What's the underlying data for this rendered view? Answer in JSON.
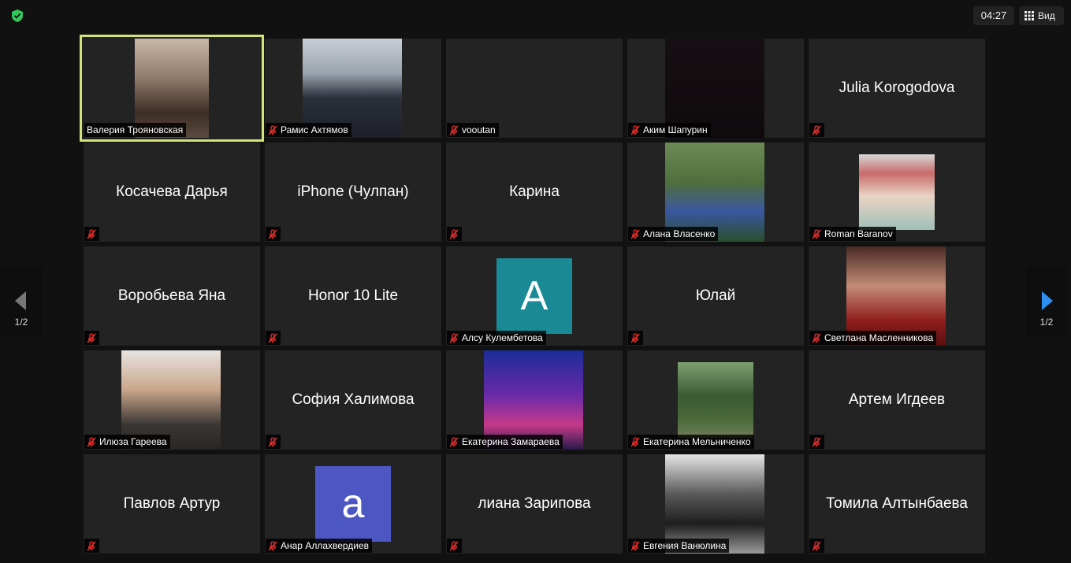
{
  "timer": "04:27",
  "view_label": "Вид",
  "page_indicator": "1/2",
  "colors": {
    "speaking_border": "#d4e27a",
    "mute_red": "#e63232",
    "shield_green": "#33c95a",
    "arrow_blue": "#2e8ff0",
    "avatar_teal": "#1a8a96",
    "avatar_indigo": "#4d57c4"
  },
  "participants": [
    {
      "id": "t0",
      "name": "Валерия Трояновская",
      "type": "video",
      "muted": false,
      "speaking": true
    },
    {
      "id": "t1",
      "name": "Рамис Ахтямов",
      "type": "video",
      "muted": true
    },
    {
      "id": "t2",
      "name": "vooutan",
      "type": "blank",
      "muted": true
    },
    {
      "id": "t3",
      "name": "Аким Шапурин",
      "type": "video",
      "muted": true
    },
    {
      "id": "t4",
      "name": "Julia Korogodova",
      "type": "name",
      "muted": true
    },
    {
      "id": "t5",
      "name": "Косачева Дарья",
      "type": "name",
      "muted": true
    },
    {
      "id": "t6",
      "name": "iPhone (Чулпан)",
      "type": "name",
      "muted": true
    },
    {
      "id": "t7",
      "name": "Карина",
      "type": "name",
      "muted": true
    },
    {
      "id": "t8",
      "name": "Алана Власенко",
      "type": "video",
      "muted": true
    },
    {
      "id": "t9",
      "name": "Roman Baranov",
      "type": "video",
      "muted": true
    },
    {
      "id": "t10",
      "name": "Воробьева Яна",
      "type": "name",
      "muted": true
    },
    {
      "id": "t11",
      "name": "Honor 10 Lite",
      "type": "name",
      "muted": true
    },
    {
      "id": "t12",
      "name": "Алсу Кулембетова",
      "type": "avatar",
      "avatar_letter": "A",
      "muted": true
    },
    {
      "id": "t13",
      "name": "Юлай",
      "type": "name",
      "muted": true
    },
    {
      "id": "t14",
      "name": "Светлана Масленникова",
      "type": "video",
      "muted": true
    },
    {
      "id": "t15",
      "name": "Илюза Гареева",
      "type": "video",
      "muted": true
    },
    {
      "id": "t16",
      "name": "София Халимова",
      "type": "name",
      "muted": true
    },
    {
      "id": "t17",
      "name": "Екатерина Замараева",
      "type": "video",
      "muted": true
    },
    {
      "id": "t18",
      "name": "Екатерина Мельниченко",
      "type": "video",
      "muted": true
    },
    {
      "id": "t19",
      "name": "Артем Игдеев",
      "type": "name",
      "muted": true
    },
    {
      "id": "t20",
      "name": "Павлов Артур",
      "type": "name",
      "muted": true
    },
    {
      "id": "t21",
      "name": "Анар Аллахвердиев",
      "type": "avatar",
      "avatar_letter": "a",
      "muted": true
    },
    {
      "id": "t22",
      "name": "лиана Зарипова",
      "type": "name",
      "muted": true
    },
    {
      "id": "t23",
      "name": "Евгения Ванюлина",
      "type": "video",
      "muted": true
    },
    {
      "id": "t24",
      "name": "Томила Алтынбаева",
      "type": "name",
      "muted": true
    }
  ]
}
